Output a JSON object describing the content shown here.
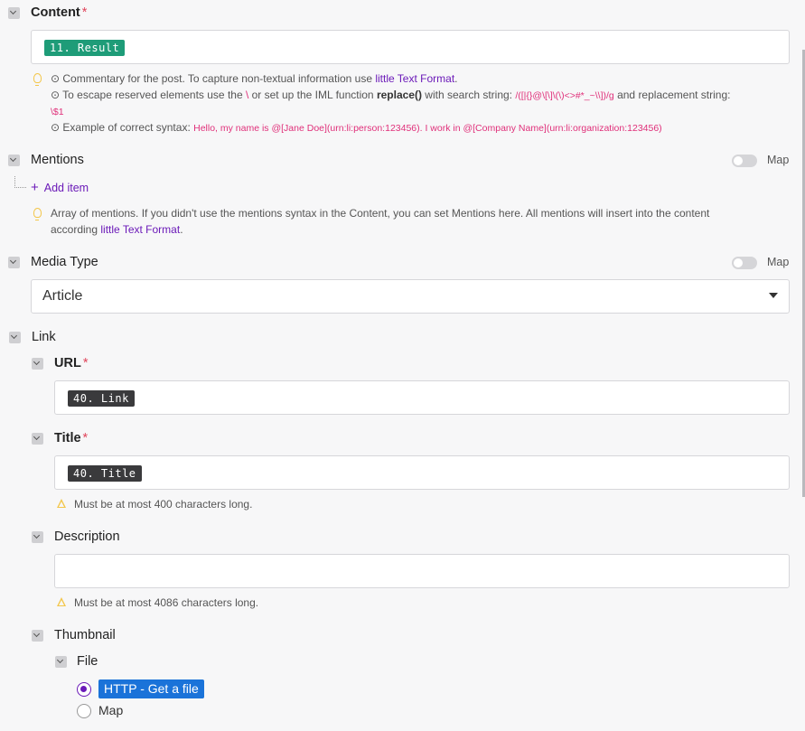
{
  "content": {
    "label": "Content",
    "required_mark": "*",
    "value_pill": "11. Result",
    "hints": {
      "line1_prefix": "⊙ Commentary for the post. To capture non-textual information use ",
      "line1_link": "little Text Format",
      "line1_suffix": ".",
      "line2_a": "⊙ To escape reserved elements use the ",
      "line2_backslash": "\\",
      "line2_b": " or set up the IML function ",
      "line2_func": "replace()",
      "line2_c": " with search string: ",
      "line2_regex": "/([|{}@\\[\\]\\(\\)<>#*_~\\\\])/g",
      "line2_d": " and replacement string:",
      "line2_replacement": "\\$1",
      "line3_a": "⊙ Example of correct syntax: ",
      "line3_example": "Hello, my name is @[Jane Doe](urn:li:person:123456). I work in @[Company Name](urn:li:organization:123456)"
    }
  },
  "mentions": {
    "label": "Mentions",
    "map_label": "Map",
    "add_item": "Add item",
    "hint_a": "Array of mentions. If you didn't use the mentions syntax in the Content, you can set Mentions here. All mentions will insert into the content",
    "hint_b_prefix": "according ",
    "hint_b_link": "little Text Format",
    "hint_b_suffix": "."
  },
  "media_type": {
    "label": "Media Type",
    "map_label": "Map",
    "selected": "Article"
  },
  "link": {
    "label": "Link",
    "url": {
      "label": "URL",
      "required_mark": "*",
      "value_pill": "40. Link"
    },
    "title": {
      "label": "Title",
      "required_mark": "*",
      "value_pill": "40. Title",
      "warning": "Must be at most 400 characters long."
    },
    "description": {
      "label": "Description",
      "value": "",
      "warning": "Must be at most 4086 characters long."
    },
    "thumbnail": {
      "label": "Thumbnail",
      "file": {
        "label": "File",
        "options": [
          "HTTP - Get a file",
          "Map"
        ]
      }
    }
  },
  "colors": {
    "accent": "#6b1ab8",
    "pill_green": "#1e9c78",
    "pill_dark": "#3a3a3c",
    "selected_option_bg": "#1a73d9",
    "required": "#e0455b"
  }
}
